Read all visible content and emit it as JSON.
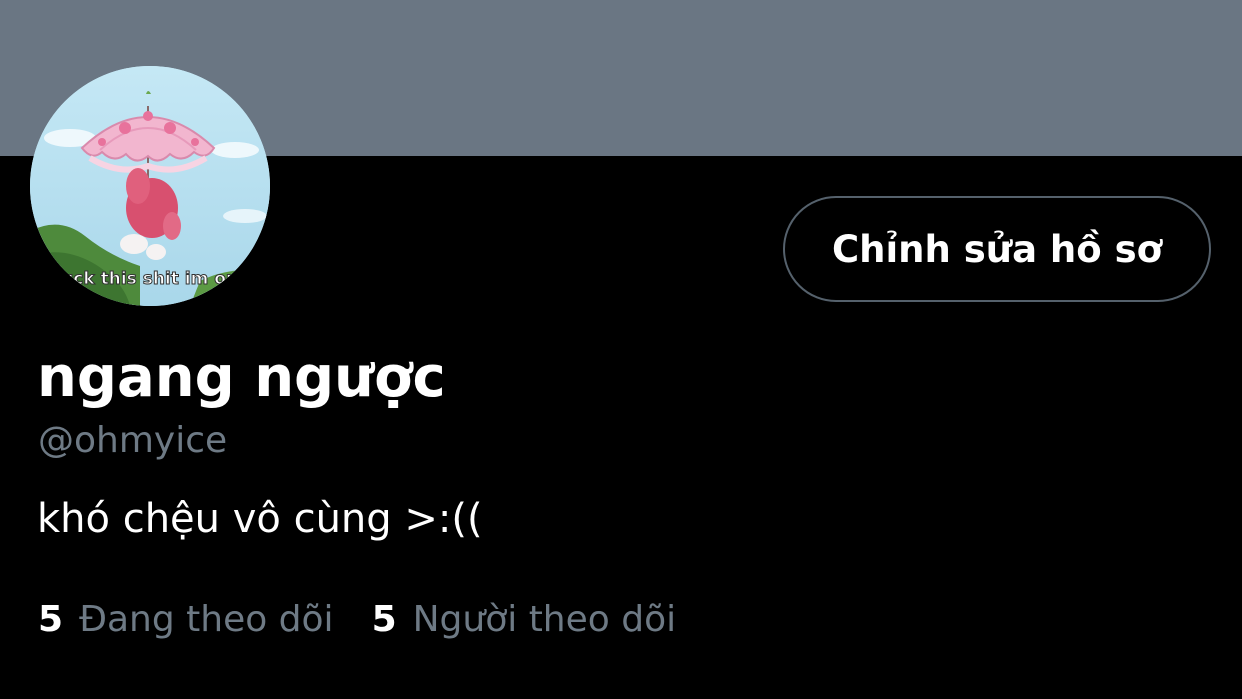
{
  "profile": {
    "display_name": "ngang ngược",
    "handle": "@ohmyice",
    "bio": "khó chệu vô cùng >:((",
    "edit_button_label": "Chỉnh sửa hồ sơ",
    "avatar_caption": "fuck this shit im out"
  },
  "stats": {
    "following_count": "5",
    "following_label": "Đang theo dõi",
    "followers_count": "5",
    "followers_label": "Người theo dõi"
  },
  "colors": {
    "banner": "#6a7683",
    "background": "#000000",
    "secondary_text": "#6e7a85",
    "button_border": "#55616c"
  }
}
